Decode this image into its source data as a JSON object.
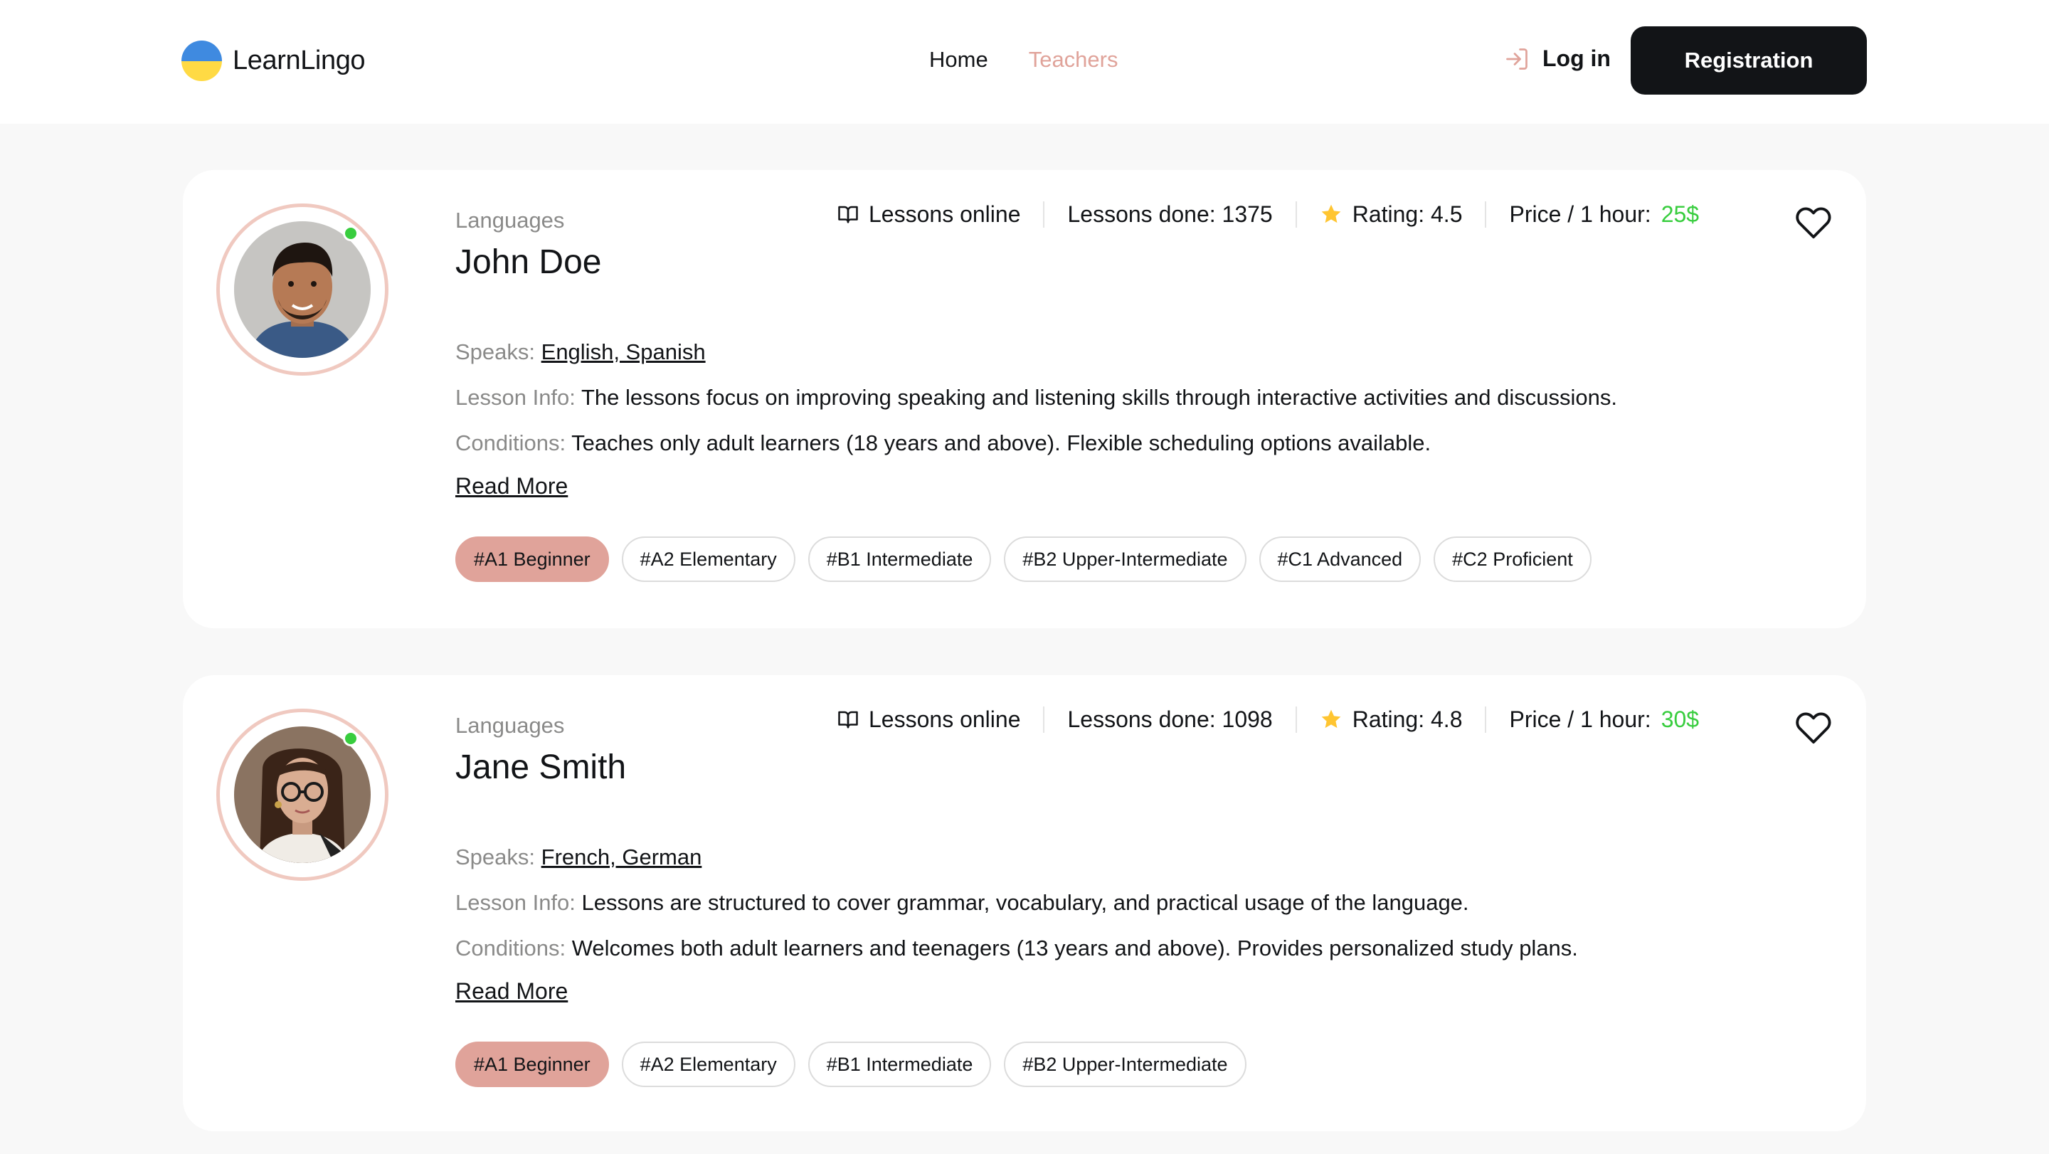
{
  "header": {
    "logo_text": "LearnLingo",
    "nav": [
      {
        "label": "Home",
        "active": false
      },
      {
        "label": "Teachers",
        "active": true
      }
    ],
    "login_label": "Log in",
    "register_label": "Registration"
  },
  "colors": {
    "accent": "#e0a39a",
    "price": "#38cd3e",
    "star": "#ffc531",
    "dark": "#121417"
  },
  "teachers": [
    {
      "languages_label": "Languages",
      "name": "John Doe",
      "lessons_online": "Lessons online",
      "lessons_done": "Lessons done: 1375",
      "rating": "Rating: 4.5",
      "price_label": "Price / 1 hour:",
      "price_value": "25$",
      "speaks_label": "Speaks:",
      "speaks": "English, Spanish",
      "lesson_info_label": "Lesson Info:",
      "lesson_info": "The lessons focus on improving speaking and listening skills through interactive activities and discussions.",
      "conditions_label": "Conditions:",
      "conditions": "Teaches only adult learners (18 years and above). Flexible scheduling options available.",
      "read_more": "Read More",
      "levels": [
        "#A1 Beginner",
        "#A2 Elementary",
        "#B1 Intermediate",
        "#B2 Upper-Intermediate",
        "#C1 Advanced",
        "#C2 Proficient"
      ]
    },
    {
      "languages_label": "Languages",
      "name": "Jane Smith",
      "lessons_online": "Lessons online",
      "lessons_done": "Lessons done: 1098",
      "rating": "Rating: 4.8",
      "price_label": "Price / 1 hour:",
      "price_value": "30$",
      "speaks_label": "Speaks:",
      "speaks": "French, German",
      "lesson_info_label": "Lesson Info:",
      "lesson_info": "Lessons are structured to cover grammar, vocabulary, and practical usage of the language.",
      "conditions_label": "Conditions:",
      "conditions": "Welcomes both adult learners and teenagers (13 years and above). Provides personalized study plans.",
      "read_more": "Read More",
      "levels": [
        "#A1 Beginner",
        "#A2 Elementary",
        "#B1 Intermediate",
        "#B2 Upper-Intermediate"
      ]
    }
  ]
}
